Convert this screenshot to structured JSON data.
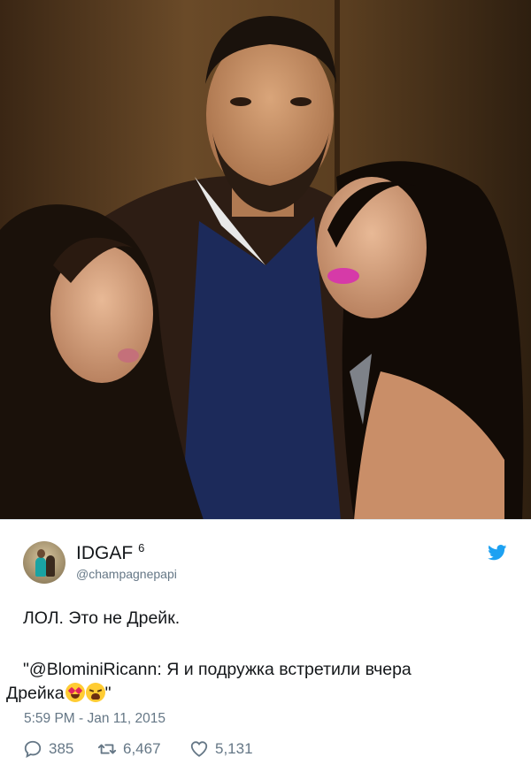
{
  "photo": {
    "alt_description": ""
  },
  "tweet": {
    "display_name": "IDGAF",
    "superscript": "6",
    "handle": "@champagnepapi",
    "line1": "ЛОЛ. Это не Дрейк.",
    "line2": "\"@BlominiRicann: Я и подружка встретили вчера",
    "line3_text": "Дрейка",
    "line3_end": "\"",
    "timestamp": "5:59 PM - Jan 11, 2015",
    "replies": "385",
    "retweets": "6,467",
    "likes": "5,131",
    "emojis": [
      "heart-eyes-emoji",
      "weary-face-emoji"
    ],
    "colors": {
      "twitter_blue": "#1da1f2",
      "meta_gray": "#657786",
      "text": "#14171a"
    }
  }
}
